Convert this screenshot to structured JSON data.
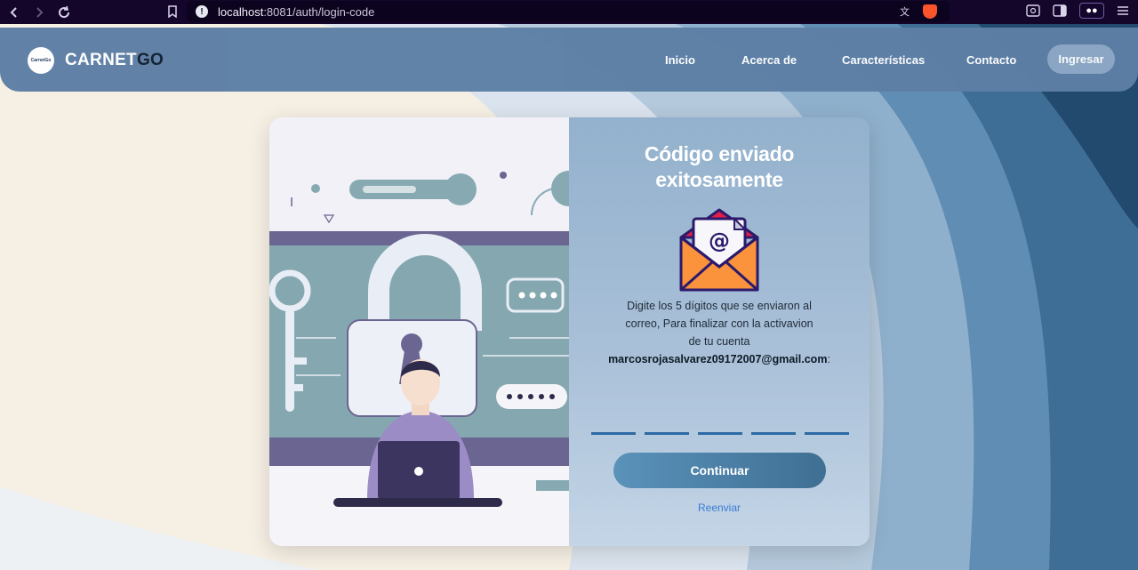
{
  "browser": {
    "url_host": "localhost",
    "url_rest": ":8081/auth/login-code"
  },
  "header": {
    "brand_main": "CARNET",
    "brand_accent": "GO",
    "logo_text": "CarnetGo",
    "menu": [
      "Inicio",
      "Acerca de",
      "Características",
      "Contacto"
    ],
    "login_label": "Ingresar"
  },
  "panel": {
    "title_line1": "Código enviado",
    "title_line2": "exitosamente",
    "instructions_line1": "Digite los 5 dígitos que se enviaron al",
    "instructions_line2": "correo, Para finalizar con la activavion",
    "instructions_line3": "de tu cuenta",
    "email": "marcosrojasalvarez09172007@gmail.com",
    "email_suffix": ":",
    "digit_count": 5,
    "continue_label": "Continuar",
    "resend_label": "Reenviar"
  },
  "colors": {
    "header_bg": "#5d7fa5",
    "button_start": "#5a92ba",
    "button_end": "#3f6f93",
    "link": "#3a7bd5"
  }
}
